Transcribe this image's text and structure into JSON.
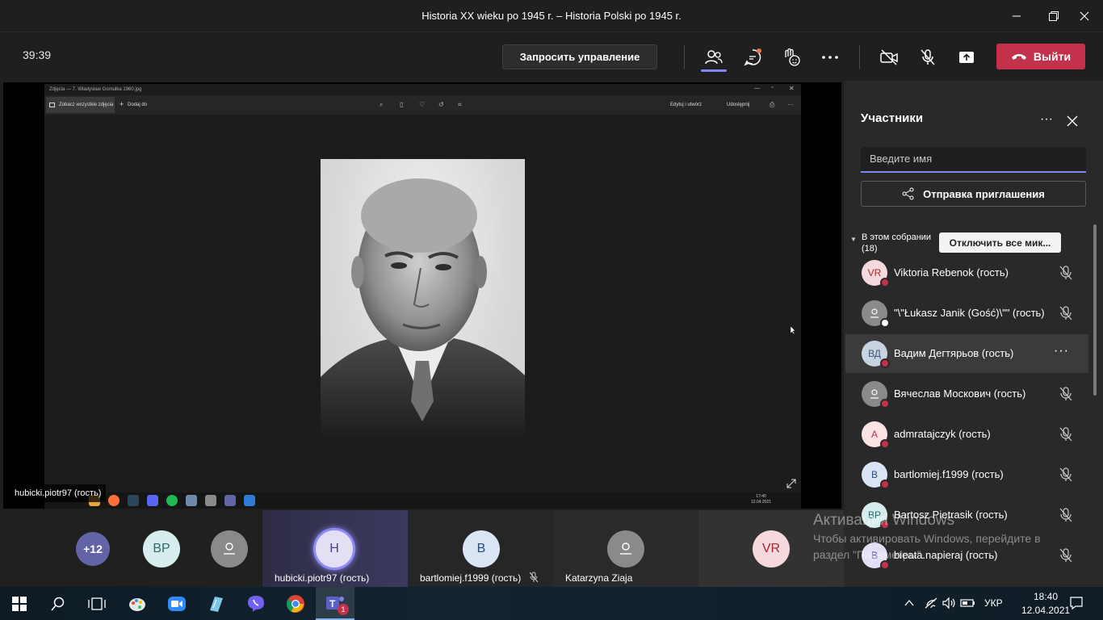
{
  "window": {
    "title": "Historia XX wieku po 1945 r. – Historia Polski po 1945 r."
  },
  "toolbar": {
    "timer": "39:39",
    "request_control_label": "Запросить управление",
    "leave_label": "Выйти",
    "leave_color": "#c4314b"
  },
  "shared_screen": {
    "window_title": "Zdjęcia — 7. Władysław Gomułka 1960.jpg",
    "see_all_label": "Zobacz wszystkie zdjęcia",
    "add_label": "Dodaj do",
    "edit_label": "Edytuj i utwórz",
    "share_label": "Udostępnij",
    "clock_time": "17:40",
    "clock_date": "12.04.2021",
    "presenter": "hubicki.piotr97 (гость)"
  },
  "participants_panel": {
    "title": "Участники",
    "search_placeholder": "Введите имя",
    "invite_label": "Отправка приглашения",
    "section_label": "В этом собрании (18)",
    "mute_all_label": "Отключить все мик...",
    "people": [
      {
        "initials": "VR",
        "name": "Viktoria Rebenok (гость)",
        "avatar_bg": "#f6d9dc",
        "avatar_fg": "#a4262c",
        "status_color": "#c4314b"
      },
      {
        "initials": "",
        "name": "\"\\\"Łukasz Janik (Gość)\\\"\" (гость)",
        "avatar_bg": "#8a8a8a",
        "avatar_fg": "#ffffff",
        "status_color": "#ffffff"
      },
      {
        "initials": "ВД",
        "name": "Вадим Дегтярьов (гость)",
        "avatar_bg": "#c7d3e0",
        "avatar_fg": "#40587c",
        "status_color": "#c4314b"
      },
      {
        "initials": "",
        "name": "Вячеслав Москович (гость)",
        "avatar_bg": "#8a8a8a",
        "avatar_fg": "#ffffff",
        "status_color": "#c4314b"
      },
      {
        "initials": "A",
        "name": "admratajczyk (гость)",
        "avatar_bg": "#fbe3e3",
        "avatar_fg": "#c4314b",
        "status_color": "#c4314b"
      },
      {
        "initials": "B",
        "name": "bartlomiej.f1999 (гость)",
        "avatar_bg": "#d9e4f5",
        "avatar_fg": "#2b4a7e",
        "status_color": "#c4314b"
      },
      {
        "initials": "BP",
        "name": "Bartosz Pietrasik (гость)",
        "avatar_bg": "#d7ecec",
        "avatar_fg": "#2e6b6b",
        "status_color": "#c4314b"
      },
      {
        "initials": "B",
        "name": "bieata.napieraj (гость)",
        "avatar_bg": "#e3e0f5",
        "avatar_fg": "#4b3e8e",
        "status_color": "#c4314b"
      }
    ]
  },
  "bottom_strip": {
    "overflow": "+12",
    "tiles": [
      {
        "initials": "BP",
        "label": ""
      },
      {
        "initials": "",
        "label": ""
      },
      {
        "initials": "H",
        "label": "hubicki.piotr97 (гость)"
      },
      {
        "initials": "B",
        "label": "bartlomiej.f1999 (гость)"
      },
      {
        "initials": "",
        "label": "Katarzyna Ziaja"
      },
      {
        "initials": "VR",
        "label": ""
      }
    ]
  },
  "watermark": {
    "line1": "Активация Windows",
    "line2": "Чтобы активировать Windows, перейдите в раздел \"Параметры\"."
  },
  "taskbar": {
    "language": "УКР",
    "time": "18:40",
    "date": "12.04.2021",
    "teams_badge": "1"
  }
}
